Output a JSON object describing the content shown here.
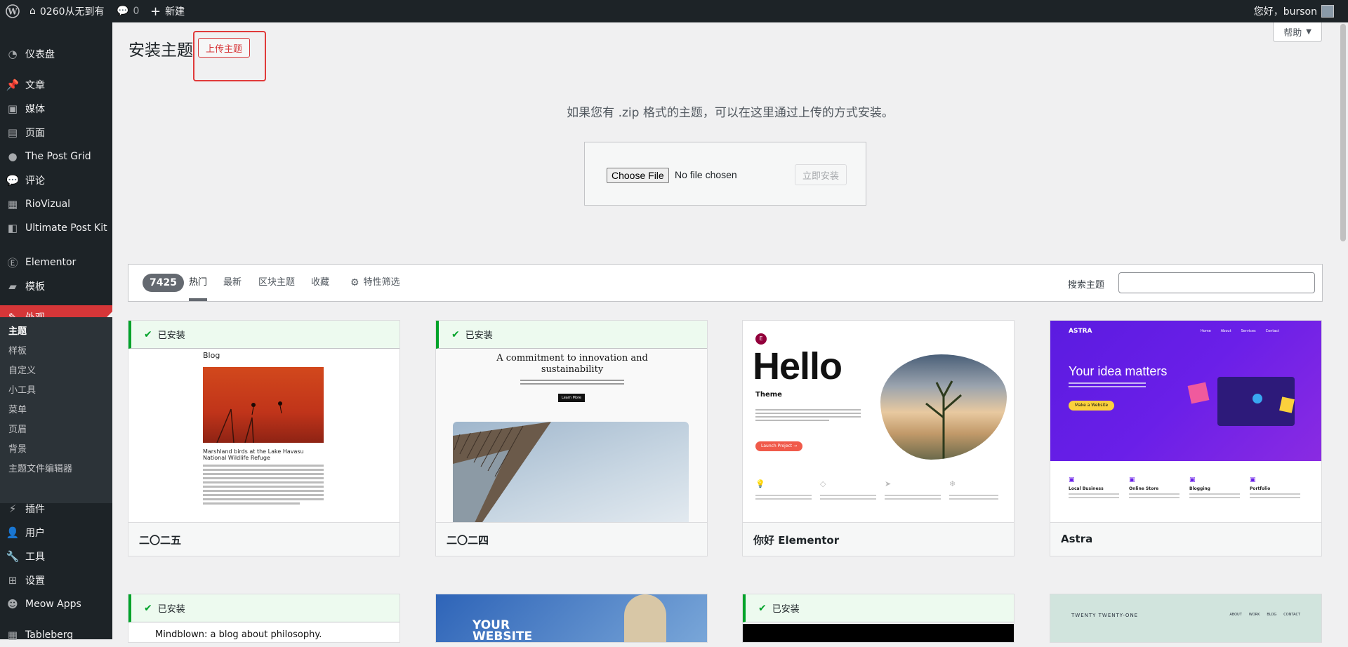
{
  "adminbar": {
    "site_name": "0260从无到有",
    "comments_count": "0",
    "new_label": "新建",
    "howdy": "您好，burson"
  },
  "sidebar": {
    "items": [
      {
        "label": "仪表盘",
        "icon": "dashboard-icon"
      },
      {
        "label": "文章",
        "icon": "pin-icon"
      },
      {
        "label": "媒体",
        "icon": "media-icon"
      },
      {
        "label": "页面",
        "icon": "page-icon"
      },
      {
        "label": "The Post Grid",
        "icon": "post-grid-icon"
      },
      {
        "label": "评论",
        "icon": "comment-icon"
      },
      {
        "label": "RioVizual",
        "icon": "riovizual-icon"
      },
      {
        "label": "Ultimate Post Kit",
        "icon": "upk-icon"
      },
      {
        "label": "Elementor",
        "icon": "elementor-icon"
      },
      {
        "label": "模板",
        "icon": "folder-icon"
      },
      {
        "label": "外观",
        "icon": "brush-icon"
      },
      {
        "label": "插件",
        "icon": "plugin-icon"
      },
      {
        "label": "用户",
        "icon": "user-icon"
      },
      {
        "label": "工具",
        "icon": "wrench-icon"
      },
      {
        "label": "设置",
        "icon": "settings-icon"
      },
      {
        "label": "Meow Apps",
        "icon": "meow-icon"
      },
      {
        "label": "Tableberg",
        "icon": "table-icon"
      }
    ],
    "submenu": [
      "主题",
      "样板",
      "自定义",
      "小工具",
      "菜单",
      "页眉",
      "背景",
      "主题文件编辑器"
    ]
  },
  "main": {
    "title": "安装主题",
    "upload_button": "上传主题",
    "help_label": "帮助",
    "upload_description": "如果您有 .zip 格式的主题，可以在这里通过上传的方式安装。",
    "choose_file_label": "Choose File",
    "no_file_text": "No file chosen",
    "install_now_label": "立即安装"
  },
  "filter": {
    "count": "7425",
    "tabs": [
      "热门",
      "最新",
      "区块主题",
      "收藏"
    ],
    "feature_filter": "特性筛选",
    "search_label": "搜索主题"
  },
  "installed_label": "已安装",
  "themes": [
    {
      "name": "二〇二五",
      "installed": true
    },
    {
      "name": "二〇二四",
      "installed": true
    },
    {
      "name": "你好 Elementor",
      "installed": false
    },
    {
      "name": "Astra",
      "installed": false
    }
  ],
  "previews": {
    "t25_heading": "Blog",
    "t25_caption": "Marshland birds at the Lake Havasu National Wildlife Refuge",
    "t24_heading": "A commitment to innovation and sustainability",
    "t24_button": "Learn More",
    "hello_heading": "Hello",
    "hello_sub": "Theme",
    "hello_button": "Launch Project →",
    "astra_logo": "ASTRA",
    "astra_nav": [
      "Home",
      "About",
      "Services",
      "Contact"
    ],
    "astra_heading": "Your idea matters",
    "astra_button": "Make a Website",
    "astra_features": [
      "Local Business",
      "Online Store",
      "Blogging",
      "Portfolio"
    ],
    "row2_t1": "Mindblown: a blog about philosophy.",
    "row2_t2": "YOUR WEBSITE YOUR WAY",
    "row2_t4": "TWENTY TWENTY-ONE",
    "row2_t4_nav": [
      "ABOUT",
      "WORK",
      "BLOG",
      "CONTACT"
    ]
  }
}
